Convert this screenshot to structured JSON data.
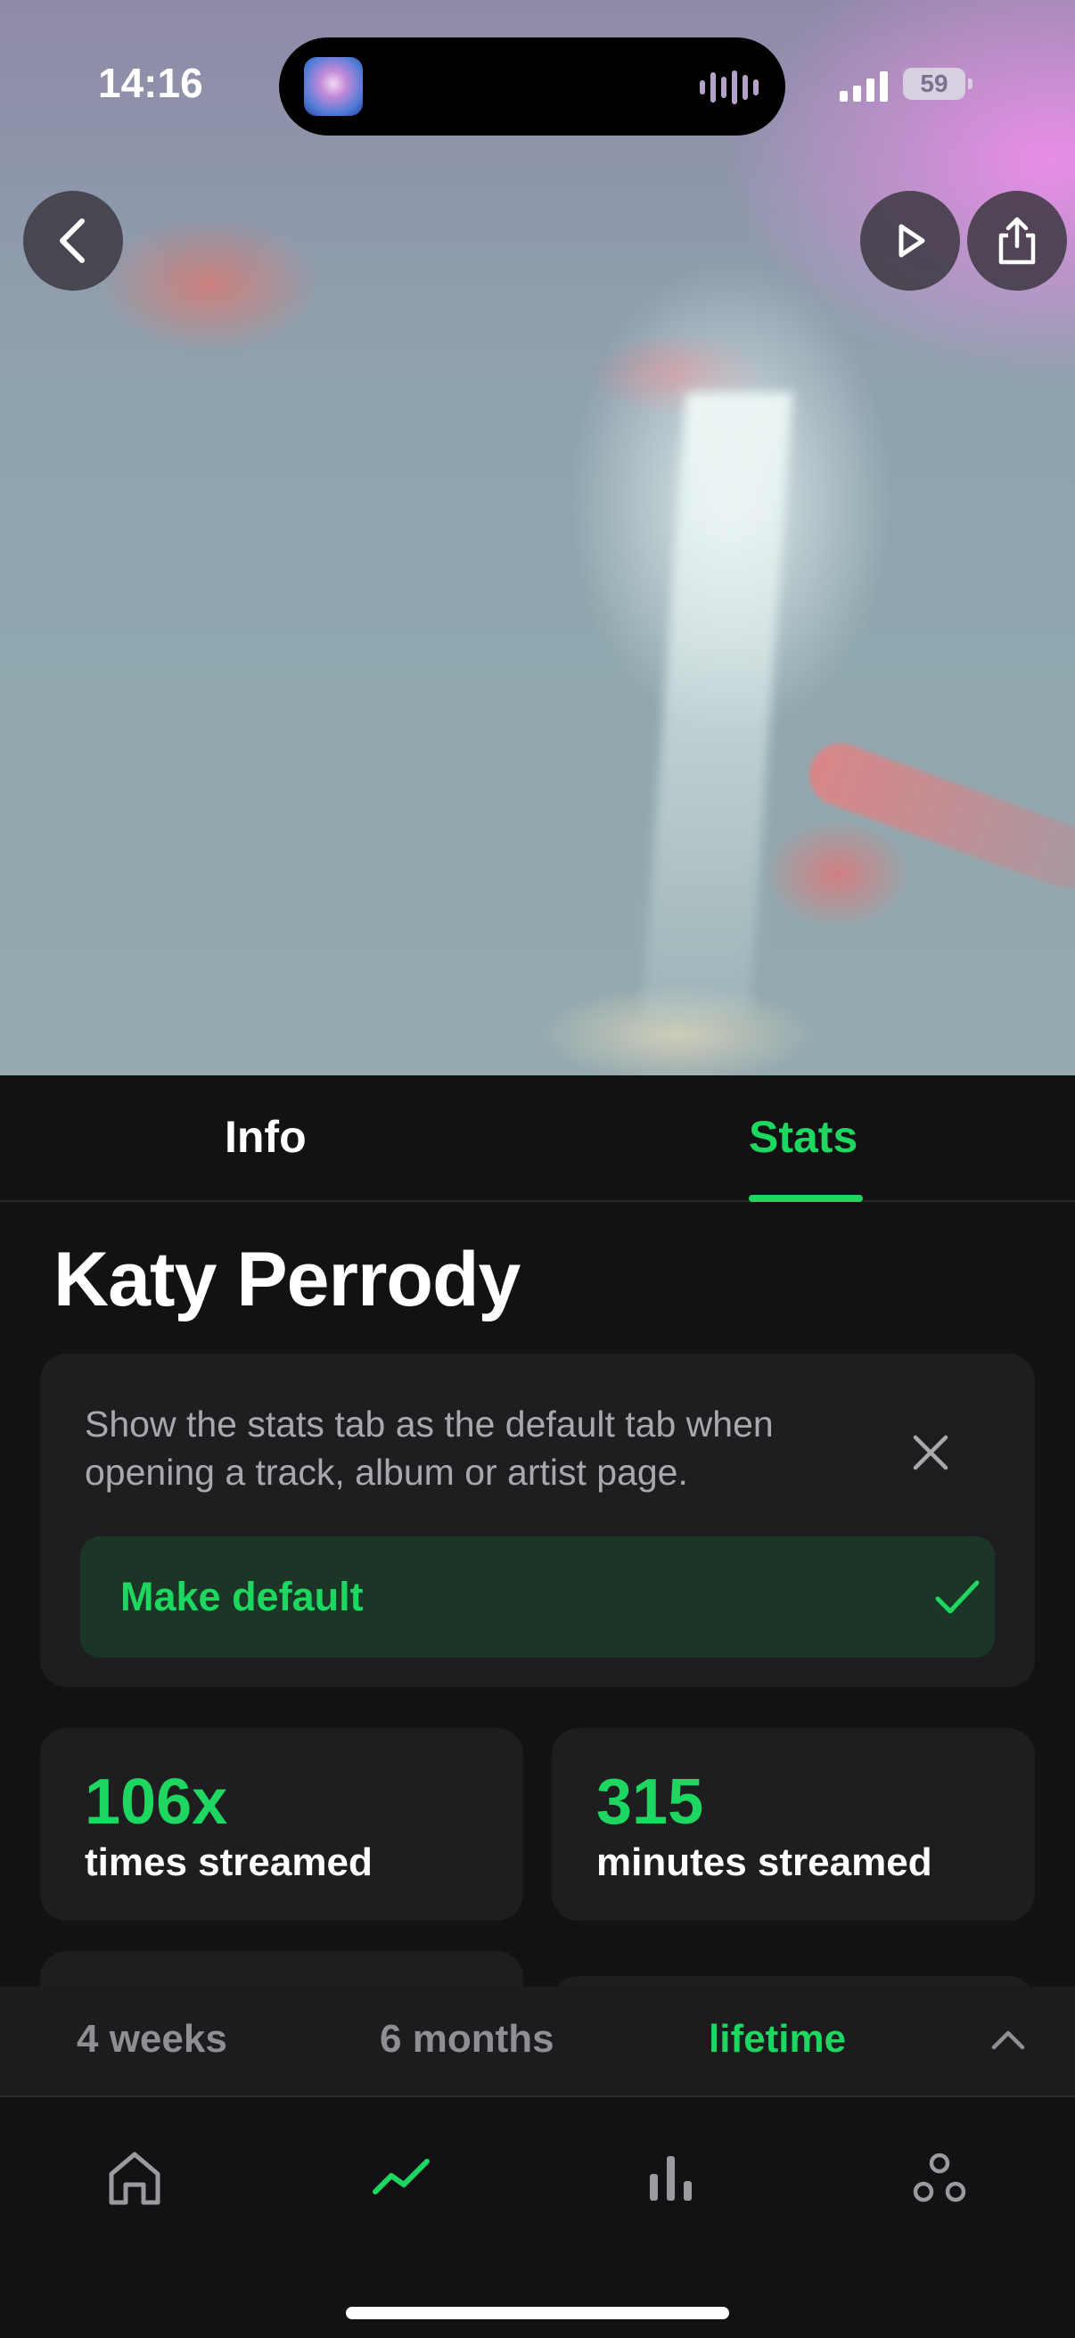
{
  "status_bar": {
    "time": "14:16",
    "battery": "59"
  },
  "tabs": [
    {
      "label": "Info",
      "active": false
    },
    {
      "label": "Stats",
      "active": true
    }
  ],
  "artist": {
    "name": "Katy Perrody"
  },
  "default_card": {
    "message": "Show the stats tab as the default tab when opening a track, album or artist page.",
    "button_label": "Make default"
  },
  "stats": [
    {
      "value": "106x",
      "label": "times streamed"
    },
    {
      "value": "315",
      "label": "minutes streamed"
    }
  ],
  "range_options": [
    {
      "label": "4 weeks",
      "selected": false
    },
    {
      "label": "6 months",
      "selected": false
    },
    {
      "label": "lifetime",
      "selected": true
    }
  ],
  "bottom_nav": [
    {
      "icon": "home-icon",
      "active": false
    },
    {
      "icon": "trending-icon",
      "active": true
    },
    {
      "icon": "bar-chart-icon",
      "active": false
    },
    {
      "icon": "friends-icon",
      "active": false
    }
  ],
  "colors": {
    "accent": "#1ed760",
    "background": "#121214",
    "card": "#1e1e21"
  }
}
